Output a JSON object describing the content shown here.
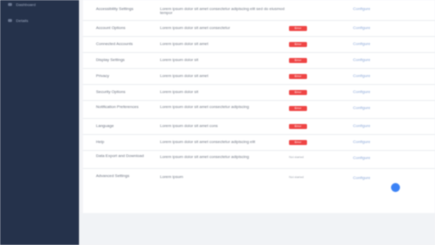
{
  "sidebar": {
    "items": [
      {
        "label": "Dashboard"
      },
      {
        "label": "Details"
      }
    ]
  },
  "table": {
    "rows": [
      {
        "name": "Accessibility Settings",
        "desc": "Lorem ipsum dolor sit amet consectetur adipiscing elit sed do eiusmod tempor",
        "status": "",
        "link": "Configure"
      },
      {
        "name": "Account Options",
        "desc": "Lorem ipsum dolor sit amet consectetur",
        "status": "Error",
        "link": "Configure"
      },
      {
        "name": "Connected Accounts",
        "desc": "Lorem ipsum dolor sit amet",
        "status": "Error",
        "link": "Configure"
      },
      {
        "name": "Display Settings",
        "desc": "Lorem ipsum dolor sit",
        "status": "Error",
        "link": "Configure"
      },
      {
        "name": "Privacy",
        "desc": "Lorem ipsum dolor sit amet",
        "status": "Error",
        "link": "Configure"
      },
      {
        "name": "Security Options",
        "desc": "Lorem ipsum dolor sit",
        "status": "Error",
        "link": "Configure"
      },
      {
        "name": "Notification Preferences",
        "desc": "Lorem ipsum dolor sit amet consectetur adipiscing",
        "status": "Error",
        "link": "Configure"
      },
      {
        "name": "Language",
        "desc": "Lorem ipsum dolor sit amet cons",
        "status": "Error",
        "link": "Configure"
      },
      {
        "name": "Help",
        "desc": "Lorem ipsum dolor sit amet consectetur adipiscing elit",
        "status": "Error",
        "link": "Configure"
      },
      {
        "name": "Data Export and Download",
        "desc": "Lorem ipsum dolor sit amet consectetur adipiscing",
        "status": "Not started",
        "link": "Configure"
      },
      {
        "name": "Advanced Settings",
        "desc": "Lorem ipsum",
        "status": "Not started",
        "link": "Configure"
      }
    ]
  }
}
